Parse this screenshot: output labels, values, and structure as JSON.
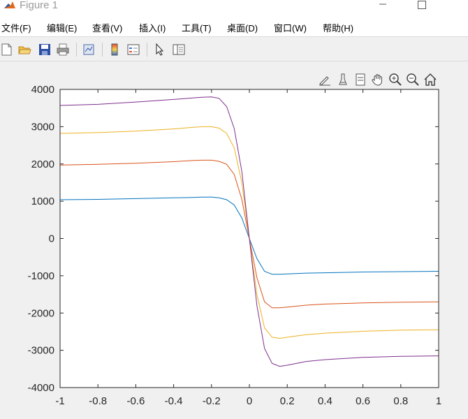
{
  "window": {
    "title": "Figure 1"
  },
  "menu": {
    "items": [
      "文件(F)",
      "编辑(E)",
      "查看(V)",
      "插入(I)",
      "工具(T)",
      "桌面(D)",
      "窗口(W)",
      "帮助(H)"
    ]
  },
  "toolbar": {
    "icons": [
      "new-figure-icon",
      "open-file-icon",
      "save-icon",
      "print-icon",
      "link-plot-icon",
      "insert-colorbar-icon",
      "insert-legend-icon",
      "edit-plot-icon",
      "property-editor-icon"
    ]
  },
  "axes_toolbar": {
    "icons": [
      "save-as-icon",
      "brush-icon",
      "data-tips-icon",
      "pan-icon",
      "zoom-in-icon",
      "zoom-out-icon",
      "home-icon"
    ]
  },
  "chart_data": {
    "type": "line",
    "title": "",
    "xlabel": "",
    "ylabel": "",
    "xlim": [
      -1,
      1
    ],
    "ylim": [
      -4000,
      4000
    ],
    "xticks": [
      "-1",
      "-0.8",
      "-0.6",
      "-0.4",
      "-0.2",
      "0",
      "0.2",
      "0.4",
      "0.6",
      "0.8",
      "1"
    ],
    "yticks": [
      "-4000",
      "-3000",
      "-2000",
      "-1000",
      "0",
      "1000",
      "2000",
      "3000",
      "4000"
    ],
    "grid": false,
    "x": [
      -1,
      -0.8,
      -0.6,
      -0.4,
      -0.3,
      -0.25,
      -0.2,
      -0.16,
      -0.12,
      -0.08,
      -0.04,
      0,
      0.04,
      0.08,
      0.12,
      0.16,
      0.2,
      0.3,
      0.4,
      0.6,
      0.8,
      1
    ],
    "series": [
      {
        "color": "#0072bd",
        "values": [
          1040,
          1050,
          1070,
          1090,
          1100,
          1110,
          1110,
          1090,
          1040,
          900,
          550,
          0,
          -540,
          -880,
          -960,
          -960,
          -950,
          -930,
          -920,
          -900,
          -890,
          -880
        ]
      },
      {
        "color": "#d95319",
        "values": [
          1970,
          1990,
          2020,
          2060,
          2090,
          2100,
          2100,
          2070,
          1990,
          1720,
          1050,
          0,
          -1050,
          -1700,
          -1860,
          -1860,
          -1840,
          -1790,
          -1760,
          -1730,
          -1710,
          -1700
        ]
      },
      {
        "color": "#edb120",
        "values": [
          2820,
          2840,
          2880,
          2940,
          2980,
          3000,
          3000,
          2960,
          2820,
          2430,
          1500,
          0,
          -1500,
          -2400,
          -2650,
          -2680,
          -2650,
          -2580,
          -2540,
          -2490,
          -2460,
          -2450
        ]
      },
      {
        "color": "#7e2f8e",
        "values": [
          3570,
          3600,
          3660,
          3730,
          3770,
          3790,
          3800,
          3760,
          3540,
          2950,
          1800,
          0,
          -1800,
          -2950,
          -3350,
          -3430,
          -3400,
          -3300,
          -3250,
          -3190,
          -3160,
          -3150
        ]
      }
    ]
  }
}
